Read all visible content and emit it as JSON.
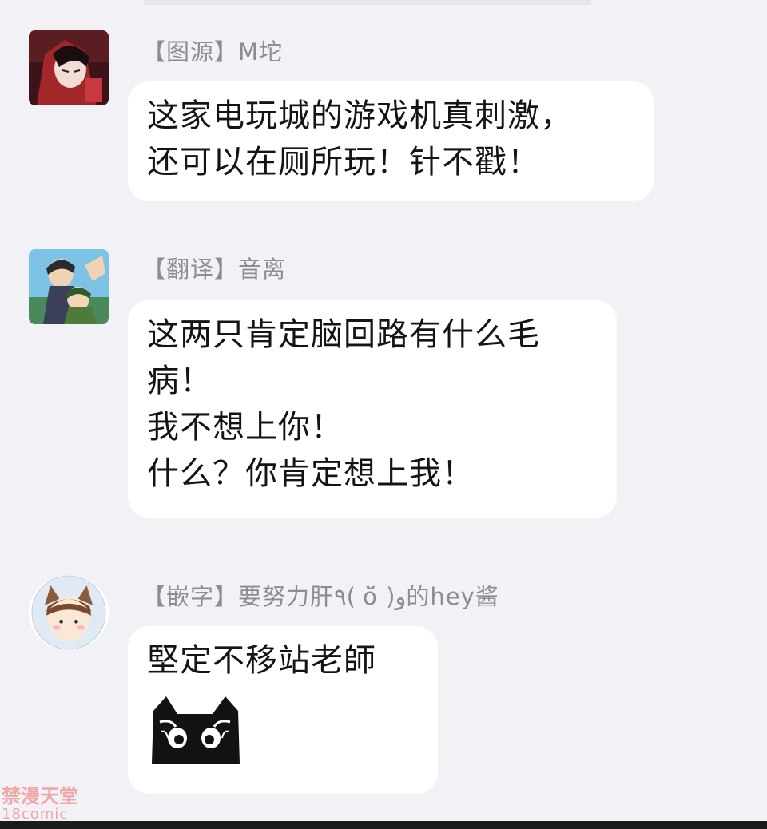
{
  "messages": [
    {
      "sender": "【图源】M坨",
      "lines": [
        "这家电玩城的游戏机真刺激，",
        "还可以在厕所玩！针不戳！"
      ]
    },
    {
      "sender": "【翻译】音离",
      "lines": [
        "这两只肯定脑回路有什么毛",
        "病！",
        "我不想上你！",
        "什么？你肯定想上我！"
      ]
    },
    {
      "sender": "【嵌字】要努力肝٩( ŏ̆ )و的hey酱",
      "lines": [
        "堅定不移站老師"
      ],
      "sticker": "black-cat-sticker"
    }
  ],
  "watermark": {
    "line1": "禁漫天堂",
    "line2": "18comic"
  },
  "colors": {
    "background": "#f1f1f6",
    "bubble": "#ffffff",
    "sender_text": "#8b8d95",
    "message_text": "#141414"
  }
}
